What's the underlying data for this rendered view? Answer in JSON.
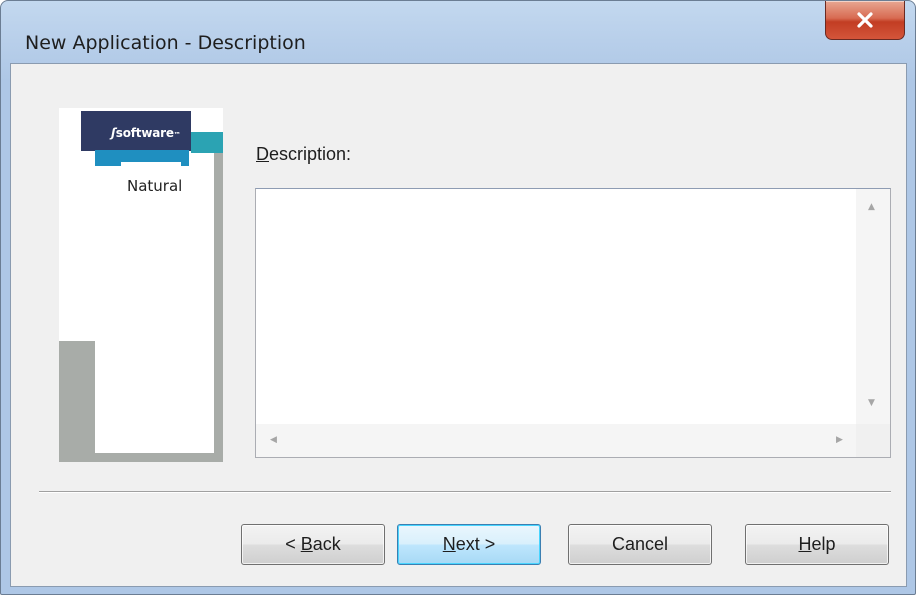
{
  "window": {
    "title": "New Application - Description",
    "close_icon": "close-icon"
  },
  "logo": {
    "brand_text": "software",
    "product_text": "Natural",
    "colors": {
      "dark_navy": "#2f3a63",
      "teal": "#2ba3b3",
      "blue": "#1f8fc0",
      "gray": "#a8aca8"
    }
  },
  "description": {
    "label_accel": "D",
    "label_rest": "escription:",
    "value": ""
  },
  "buttons": {
    "back": {
      "prefix": "< ",
      "accel": "B",
      "rest": "ack"
    },
    "next": {
      "accel": "N",
      "rest": "ext >"
    },
    "cancel": {
      "label": "Cancel"
    },
    "help": {
      "accel": "H",
      "rest": "elp"
    }
  },
  "colors": {
    "title_bar": "#b8cfea",
    "close_button": "#c23d23",
    "dialog_background": "#f0f0f0",
    "default_button_border": "#3c7fb1"
  }
}
